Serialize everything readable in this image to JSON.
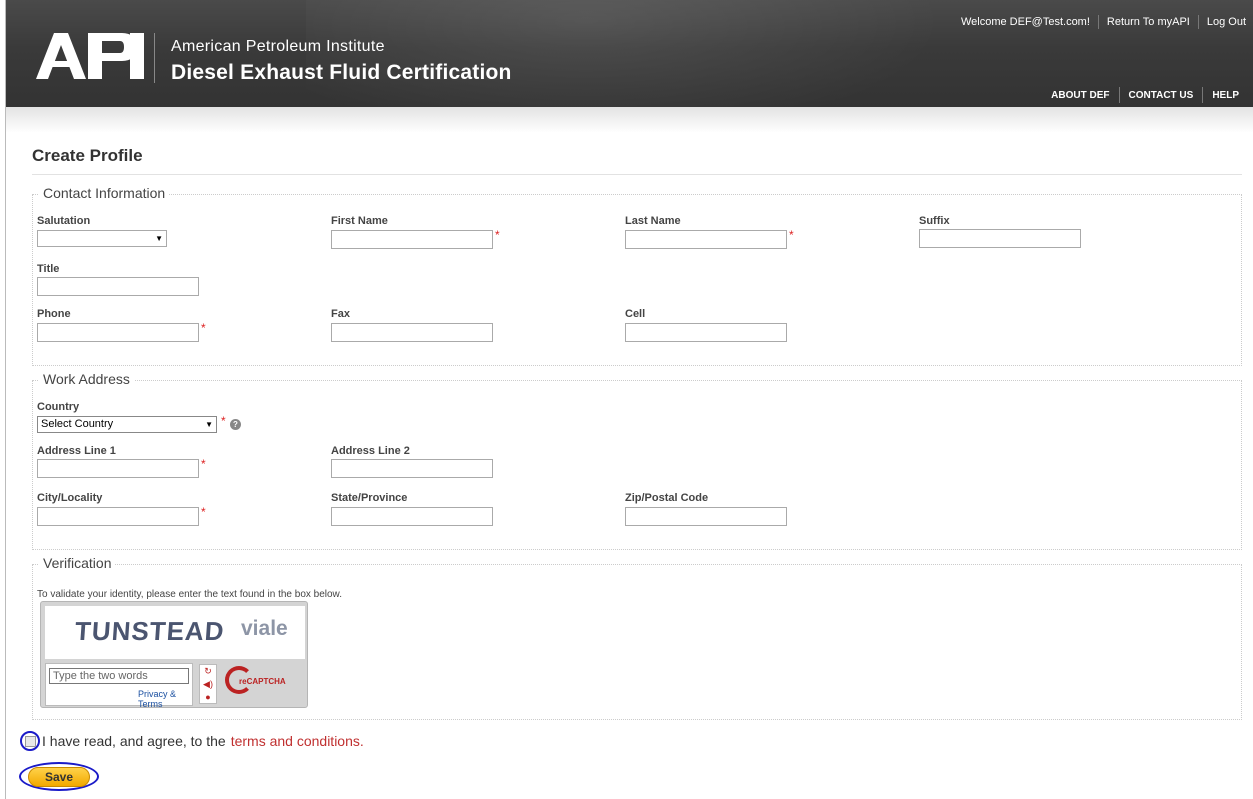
{
  "header": {
    "org_name": "American Petroleum Institute",
    "site_name": "Diesel Exhaust Fluid Certification",
    "logo_text": "API",
    "welcome": "Welcome DEF@Test.com!",
    "return_link": "Return To myAPI",
    "logout_link": "Log Out",
    "nav": [
      "ABOUT DEF",
      "CONTACT US",
      "HELP"
    ]
  },
  "page": {
    "title": "Create Profile"
  },
  "contact": {
    "legend": "Contact Information",
    "salutation": "Salutation",
    "first_name": "First Name",
    "last_name": "Last Name",
    "suffix": "Suffix",
    "title": "Title",
    "phone": "Phone",
    "fax": "Fax",
    "cell": "Cell",
    "required_mark": "*"
  },
  "address": {
    "legend": "Work Address",
    "country": "Country",
    "country_selected": "Select Country",
    "line1": "Address Line 1",
    "line2": "Address Line 2",
    "city": "City/Locality",
    "state": "State/Province",
    "zip": "Zip/Postal Code"
  },
  "verification": {
    "legend": "Verification",
    "instructions": "To validate your identity, please enter the text found in the box below.",
    "captcha_word1": "TUNSTEAD",
    "captcha_word2": "viale",
    "input_placeholder": "Type the two words",
    "privacy": "Privacy & Terms",
    "recaptcha_label": "reCAPTCHA"
  },
  "agreement": {
    "text": "I have read, and agree, to the",
    "link": "terms and conditions."
  },
  "actions": {
    "save": "Save"
  }
}
